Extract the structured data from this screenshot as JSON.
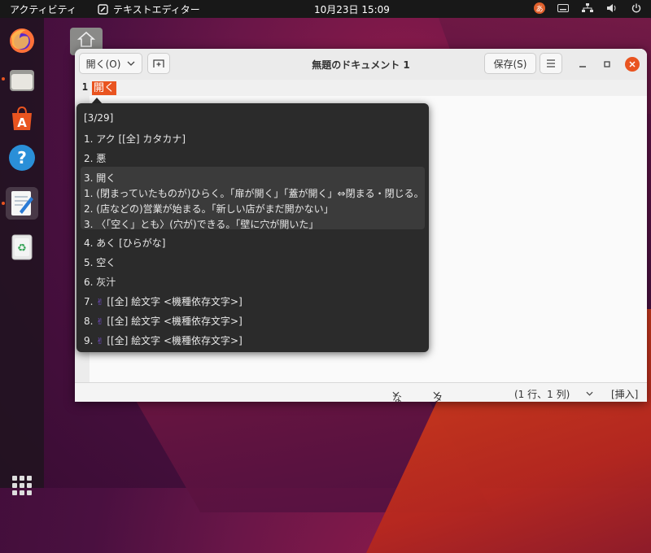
{
  "topbar": {
    "activities": "アクティビティ",
    "app_name": "テキストエディター",
    "clock": "10月23日  15:09",
    "ime_label": "あ"
  },
  "window": {
    "open_label": "開く(O)",
    "title": "無題のドキュメント 1",
    "save_label": "保存(S)"
  },
  "editor": {
    "line_number": "1",
    "preedit": "開く"
  },
  "candidates": {
    "counter": "[3/29]",
    "items": [
      "1. アク [[全] カタカナ]",
      "2. 悪",
      "3. 開く",
      "1. (閉まっていたものが)ひらく。「扉が開く」「蓋が開く」⇔閉まる・閉じる。",
      "2. (店などの)営業が始まる。「新しい店がまだ開かない」",
      "3. 〈「空く」とも〉(穴が)できる。「壁に穴が開いた」",
      "4. あく [ひらがな]",
      "5. 空く",
      "6. 灰汁",
      "7. ",
      "8. ",
      "9. "
    ],
    "emoji_suffix": "[[全] 絵文字 <機種依存文字>]"
  },
  "statusbar": {
    "syntax": "なし",
    "tab_width": "タブ幅: 8",
    "position": "(1 行、1 列)",
    "mode": "[挿入]"
  },
  "colors": {
    "accent": "#e95420",
    "popup_bg": "#2b2b2b",
    "topbar_bg": "#181818"
  }
}
